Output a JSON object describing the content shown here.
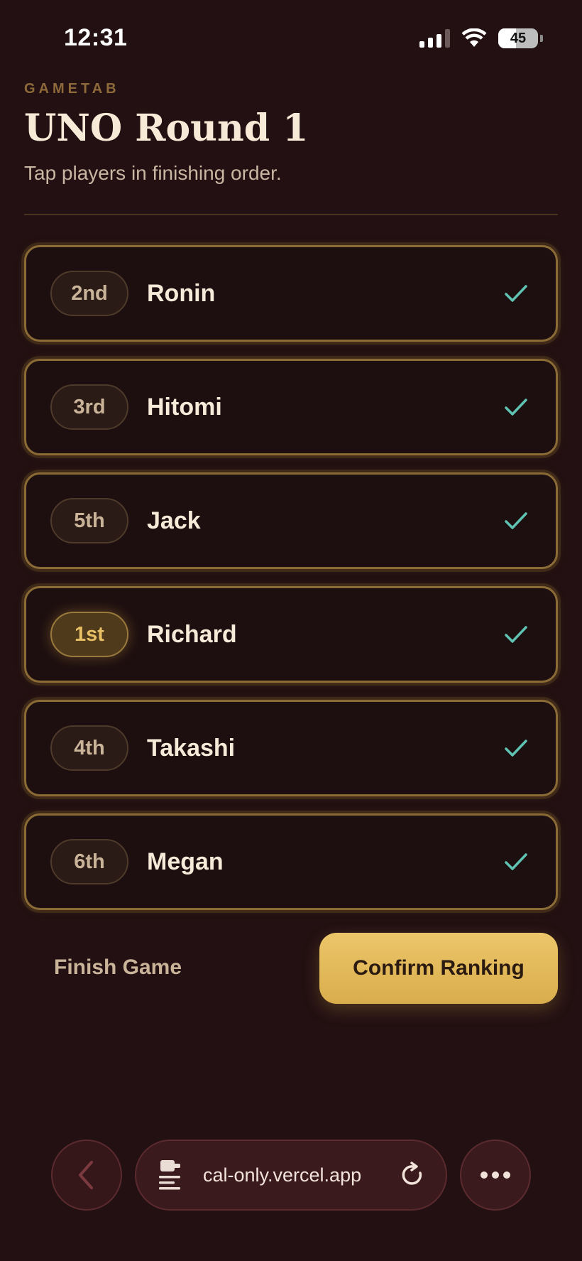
{
  "status_bar": {
    "time": "12:31",
    "battery_level": "45",
    "battery_fraction": 0.45
  },
  "header": {
    "brand": "GAMETAB",
    "title": "UNO Round 1",
    "subtitle": "Tap players in finishing order."
  },
  "players": [
    {
      "rank": "2nd",
      "name": "Ronin",
      "checked": true
    },
    {
      "rank": "3rd",
      "name": "Hitomi",
      "checked": true
    },
    {
      "rank": "5th",
      "name": "Jack",
      "checked": true
    },
    {
      "rank": "1st",
      "name": "Richard",
      "checked": true
    },
    {
      "rank": "4th",
      "name": "Takashi",
      "checked": true
    },
    {
      "rank": "6th",
      "name": "Megan",
      "checked": true
    }
  ],
  "actions": {
    "finish_label": "Finish Game",
    "confirm_label": "Confirm Ranking"
  },
  "browser": {
    "url": "cal-only.vercel.app"
  },
  "colors": {
    "background": "#221012",
    "accent_gold": "#e2b95a",
    "check_teal": "#5fc3b4",
    "card_border": "#8a6a35"
  },
  "icons": {
    "signal": "signal-icon",
    "wifi": "wifi-icon",
    "battery": "battery-icon",
    "check": "check-icon",
    "back": "chevron-left-icon",
    "reader": "reader-mode-icon",
    "reload": "reload-icon",
    "more": "more-icon"
  }
}
